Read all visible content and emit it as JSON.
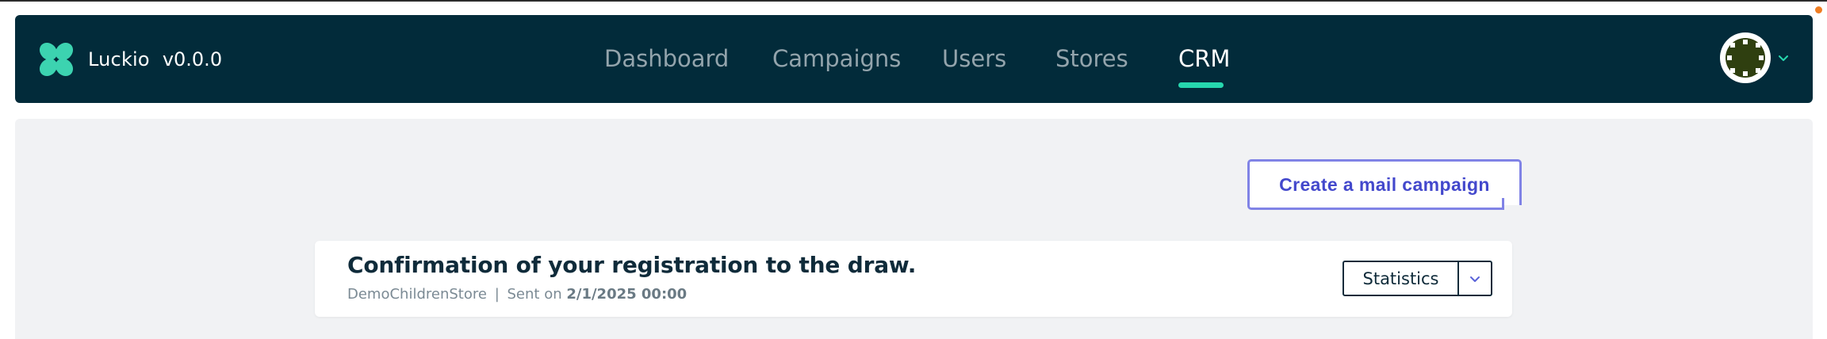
{
  "app": {
    "name": "Luckio",
    "version": "v0.0.0"
  },
  "nav": {
    "items": [
      {
        "label": "Dashboard",
        "active": false
      },
      {
        "label": "Campaigns",
        "active": false
      },
      {
        "label": "Users",
        "active": false
      },
      {
        "label": "Stores",
        "active": false
      },
      {
        "label": "CRM",
        "active": true
      }
    ]
  },
  "user_menu": {
    "avatar_icon": "avatar-icon",
    "chevron_icon": "chevron-down-icon"
  },
  "crm": {
    "create_button_label": "Create a mail campaign",
    "campaigns": [
      {
        "title": "Confirmation of your registration to the draw.",
        "store": "DemoChildrenStore",
        "separator": "|",
        "sent_prefix": "Sent on",
        "sent_date": "2/1/2025 00:00",
        "action_label": "Statistics"
      }
    ]
  },
  "colors": {
    "navbar_bg": "#022b3a",
    "accent": "#26d7ae",
    "button_accent": "#4348cc",
    "panel_bg": "#f1f2f4"
  }
}
